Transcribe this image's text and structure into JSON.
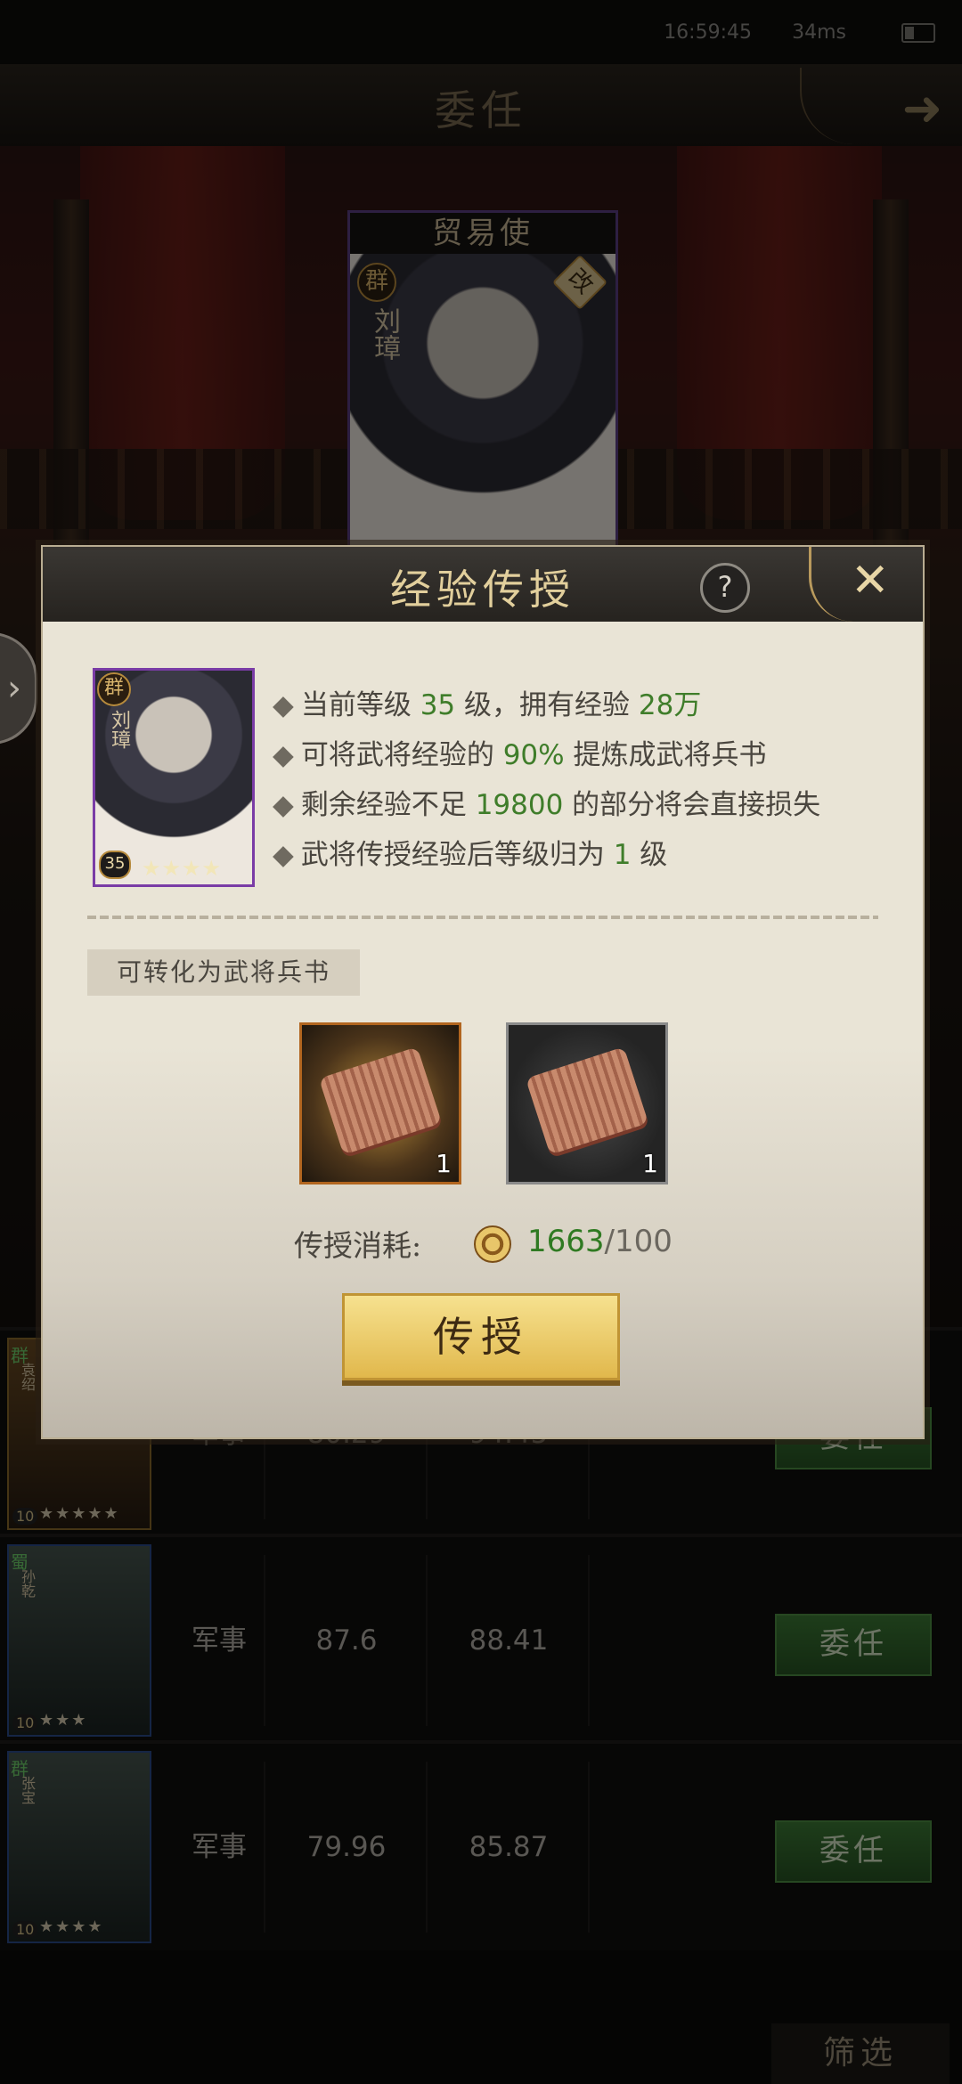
{
  "status_bar": {
    "time": "16:59:45",
    "ping": "34ms"
  },
  "header": {
    "title": "委任"
  },
  "appointment": {
    "role": "贸易使",
    "hero_faction": "群",
    "hero_name": "刘璋",
    "change_badge": "改"
  },
  "rows": [
    {
      "faction": "群",
      "name": "袁绍",
      "level": "10",
      "stars": "★★★★★",
      "category": "军事",
      "value1": "80.29",
      "value2": "94.45",
      "button": "委任"
    },
    {
      "faction": "蜀",
      "name": "孙乾",
      "level": "10",
      "stars": "★★★",
      "category": "军事",
      "value1": "87.6",
      "value2": "88.41",
      "button": "委任"
    },
    {
      "faction": "群",
      "name": "张宝",
      "level": "10",
      "stars": "★★★★",
      "category": "军事",
      "value1": "79.96",
      "value2": "85.87",
      "button": "委任"
    }
  ],
  "filter_label": "筛选",
  "dialog": {
    "title": "经验传授",
    "help_icon": "?",
    "hero": {
      "faction": "群",
      "name": "刘璋",
      "level": "35",
      "stars": "★★★★"
    },
    "info": [
      {
        "parts": [
          "当前等级 ",
          "35",
          " 级，拥有经验 ",
          "28万"
        ]
      },
      {
        "parts": [
          "可将武将经验的 ",
          "90%",
          " 提炼成武将兵书",
          ""
        ]
      },
      {
        "parts": [
          "剩余经验不足 ",
          "19800",
          " 的部分将会直接损失",
          ""
        ]
      },
      {
        "parts": [
          "武将传授经验后等级归为 ",
          "1",
          " 级",
          ""
        ]
      }
    ],
    "convert_label": "可转化为武将兵书",
    "items": [
      {
        "qty": "1"
      },
      {
        "qty": "1"
      }
    ],
    "cost_label": "传授消耗:",
    "cost_have": "1663",
    "cost_need": "/100",
    "confirm_button": "传授"
  },
  "colors": {
    "accent_green": "#3f7d2a",
    "gold": "#e1b84c",
    "purple_frame": "#7a3ca6"
  }
}
